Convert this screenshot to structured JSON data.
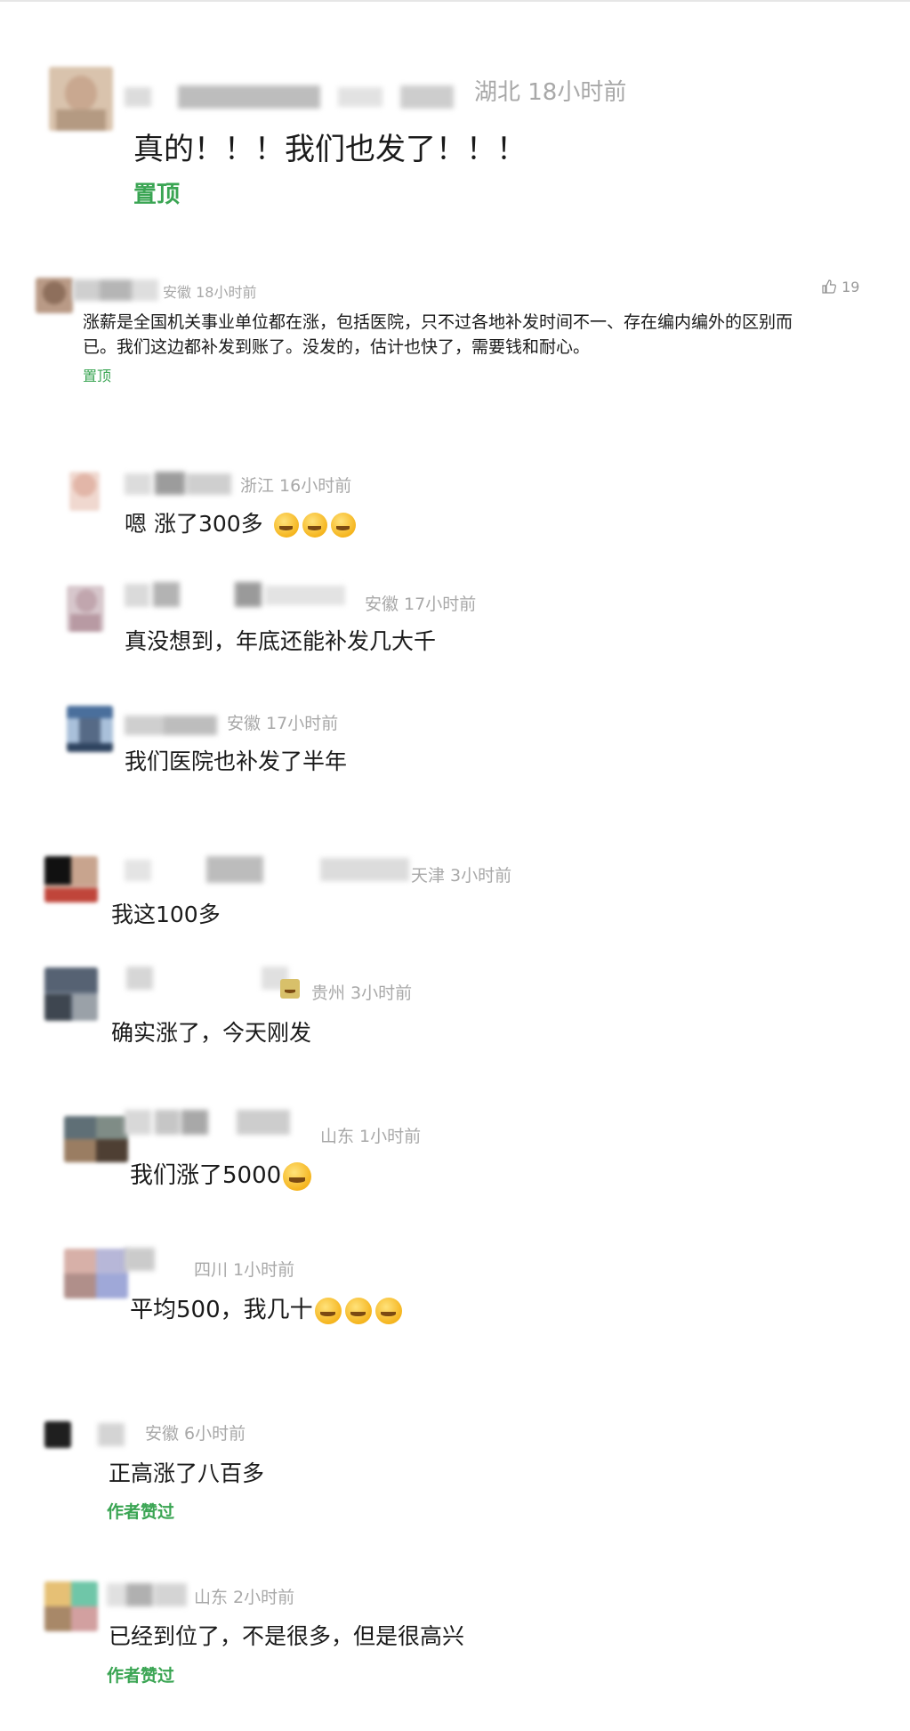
{
  "comments": [
    {
      "location_time": "湖北 18小时前",
      "text": "真的！！！我们也发了！！！",
      "tag": "置顶"
    },
    {
      "location_time": "安徽 18小时前",
      "text_line1": "涨薪是全国机关事业单位都在涨，包括医院，只不过各地补发时间不一、存在编内编外的区别而",
      "text_line2": "已。我们这边都补发到账了。没发的，估计也快了，需要钱和耐心。",
      "tag": "置顶",
      "likes": "19"
    },
    {
      "location_time": "浙江 16小时前",
      "text": "嗯 涨了300多"
    },
    {
      "location_time": "安徽 17小时前",
      "text": "真没想到，年底还能补发几大千"
    },
    {
      "location_time": "安徽 17小时前",
      "text": "我们医院也补发了半年"
    },
    {
      "location_time": "天津 3小时前",
      "text": "我这100多"
    },
    {
      "location_time": "贵州 3小时前",
      "text": "确实涨了，今天刚发"
    },
    {
      "location_time": "山东 1小时前",
      "text": "我们涨了5000"
    },
    {
      "location_time": "四川 1小时前",
      "text": "平均500，我几十"
    },
    {
      "location_time": "安徽 6小时前",
      "text": "正高涨了八百多",
      "tag": "作者赞过"
    },
    {
      "location_time": "山东 2小时前",
      "text": "已经到位了，不是很多，但是很高兴",
      "tag": "作者赞过"
    }
  ],
  "icons": {
    "like": "thumbs-up-icon",
    "emoji_cry_laugh": "crying-laughing-emoji",
    "emoji_grin": "grinning-emoji",
    "emoji_cry": "crying-emoji"
  },
  "colors": {
    "accent_green": "#3aa553",
    "meta_gray": "#a8a8a8"
  }
}
